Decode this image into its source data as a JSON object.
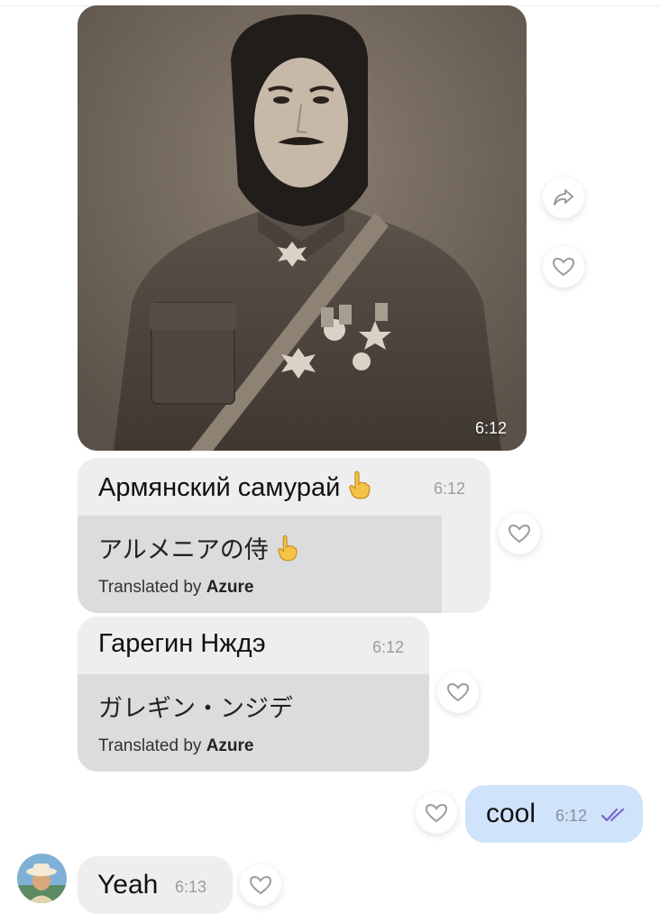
{
  "messages": {
    "photo": {
      "time": "6:12"
    },
    "msg1": {
      "original": "Армянский самурай",
      "time": "6:12",
      "translation": "アルメニアの侍",
      "credit_prefix": "Translated by",
      "credit_service": "Azure"
    },
    "msg2": {
      "original": "Гарегин Нждэ",
      "time": "6:12",
      "translation": "ガレギン・ンジデ",
      "credit_prefix": "Translated by",
      "credit_service": "Azure"
    },
    "outgoing": {
      "text": "cool",
      "time": "6:12",
      "status": "read"
    },
    "incoming": {
      "text": "Yeah",
      "time": "6:13"
    }
  },
  "icons": {
    "forward": "forward-icon",
    "like": "heart-icon",
    "read_receipt": "double-check-icon",
    "emoji": "pointing-up-emoji"
  },
  "colors": {
    "incoming_bubble": "#eeeeef",
    "translation_panel": "#dcdcdf",
    "outgoing_bubble": "#cfe3fb",
    "read_check": "#7b68c8"
  }
}
